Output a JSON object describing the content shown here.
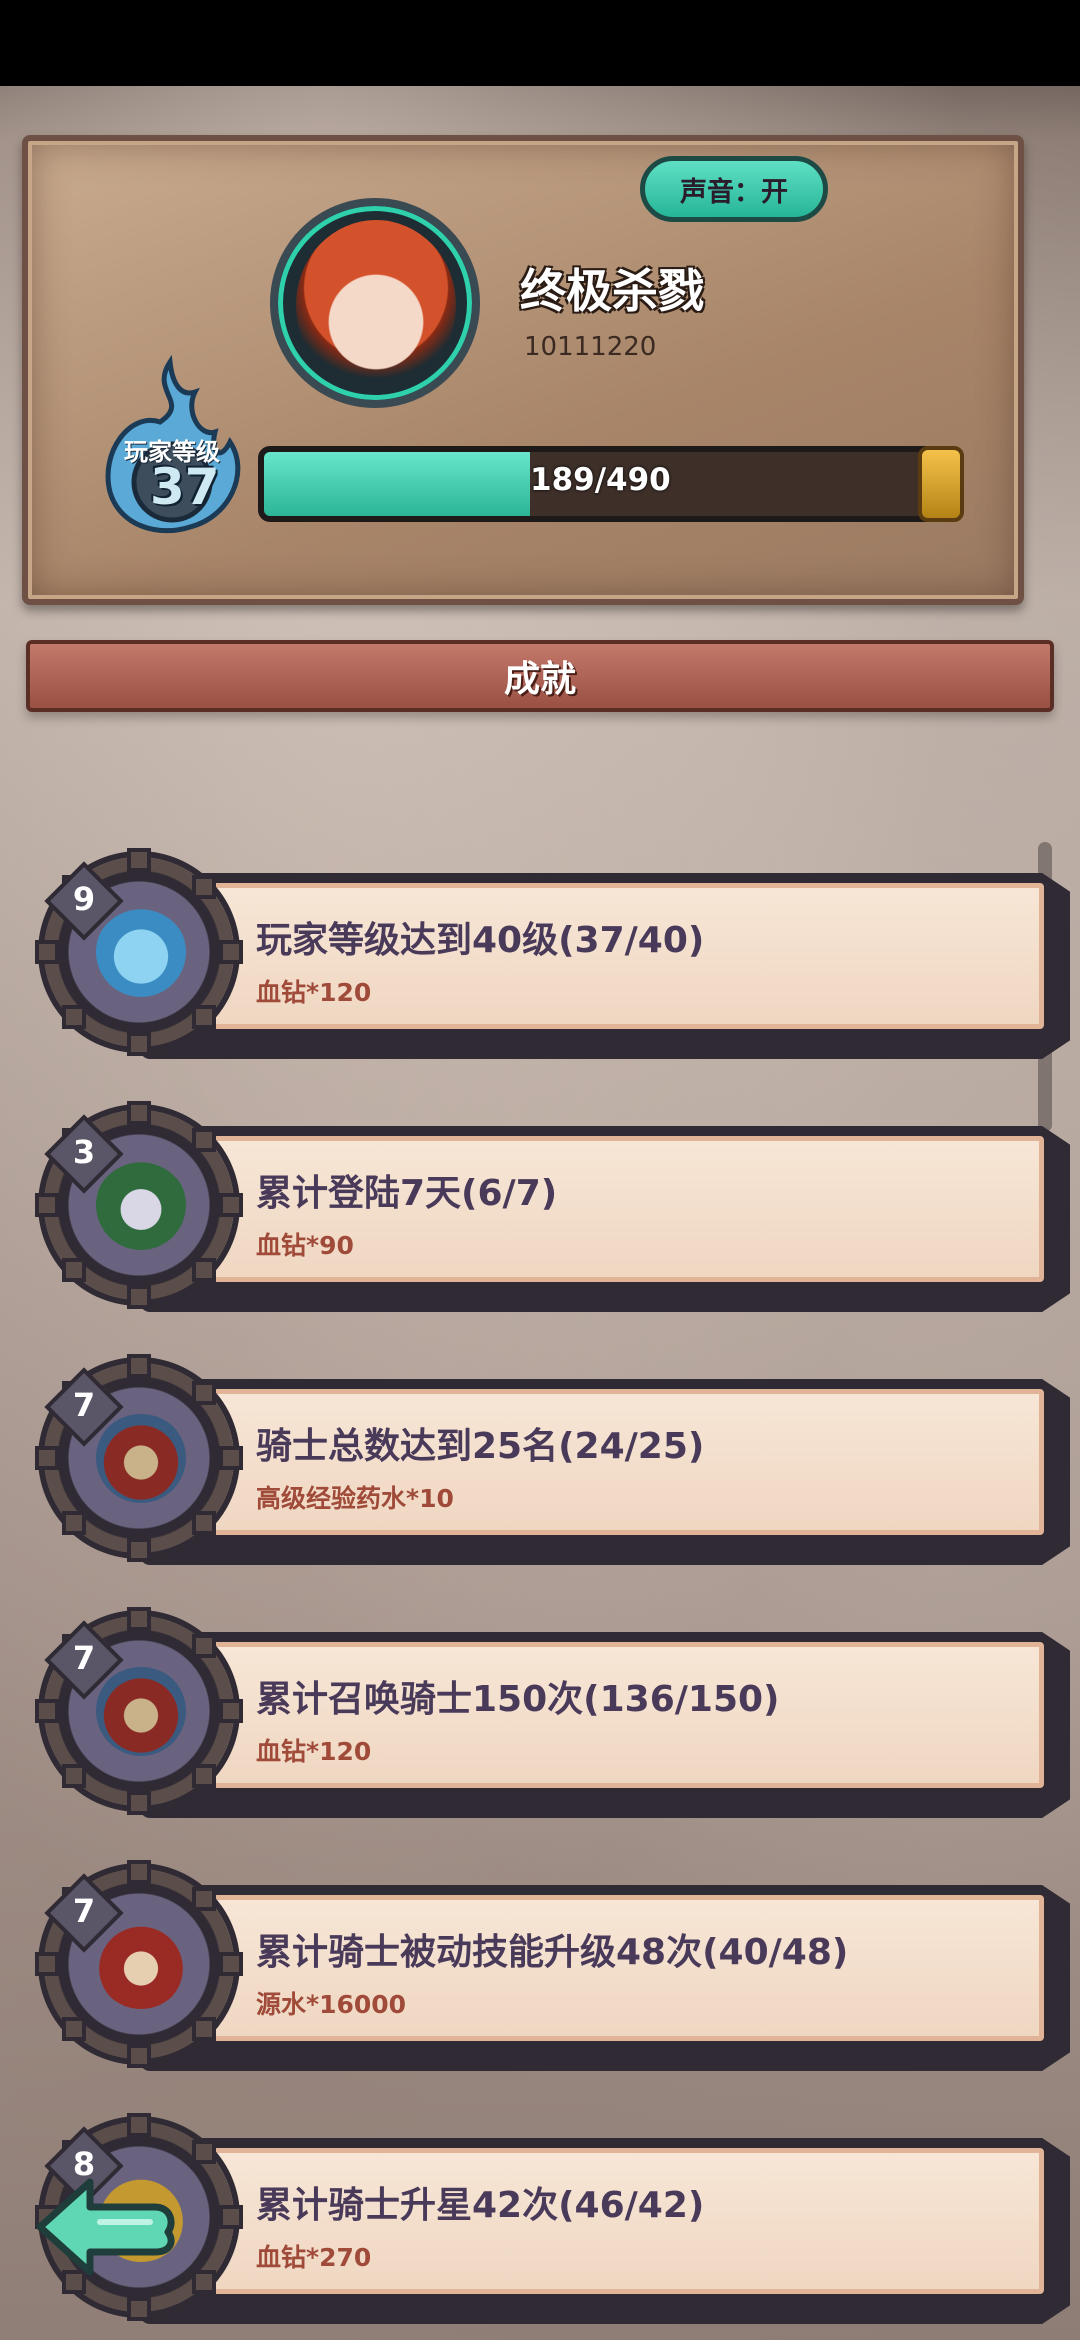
{
  "profile": {
    "sound_label": "声音：开",
    "player_name": "终极杀戮",
    "player_id": "10111220",
    "level_label": "玩家等级",
    "level": "37",
    "xp_text": "189/490",
    "xp_fraction": 0.386
  },
  "achievements_title": "成就",
  "achievements": [
    {
      "badge": "9",
      "title": "玩家等级达到40级(37/40)",
      "reward": "血钻*120",
      "icon": "blue-flame-icon"
    },
    {
      "badge": "3",
      "title": "累计登陆7天(6/7)",
      "reward": "血钻*90",
      "icon": "gear-crown-icon"
    },
    {
      "badge": "7",
      "title": "骑士总数达到25名(24/25)",
      "reward": "高级经验药水*10",
      "icon": "knights-group-icon"
    },
    {
      "badge": "7",
      "title": "累计召唤骑士150次(136/150)",
      "reward": "血钻*120",
      "icon": "knights-group-icon"
    },
    {
      "badge": "7",
      "title": "累计骑士被动技能升级48次(40/48)",
      "reward": "源水*16000",
      "icon": "knight-upgrade-icon"
    },
    {
      "badge": "8",
      "title": "累计骑士升星42次(46/42)",
      "reward": "血钻*270",
      "icon": "knight-star-icon"
    }
  ],
  "colors": {
    "accent": "#2bb596",
    "reward": "#a04a3a",
    "banner": "#9a5144"
  }
}
